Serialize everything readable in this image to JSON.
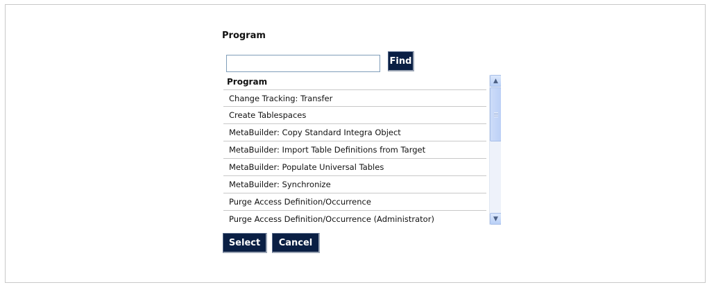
{
  "dialog": {
    "title": "Program"
  },
  "search": {
    "value": "",
    "placeholder": "",
    "find_label": "Find"
  },
  "list": {
    "header": "Program",
    "items": [
      "Change Tracking: Transfer",
      "Create Tablespaces",
      "MetaBuilder: Copy Standard Integra Object",
      "MetaBuilder: Import Table Definitions from Target",
      "MetaBuilder: Populate Universal Tables",
      "MetaBuilder: Synchronize",
      "Purge Access Definition/Occurrence",
      "Purge Access Definition/Occurrence (Administrator)"
    ]
  },
  "actions": {
    "select_label": "Select",
    "cancel_label": "Cancel"
  },
  "icons": {
    "scroll_up": "chevron-up-icon",
    "scroll_down": "chevron-down-icon"
  },
  "colors": {
    "button_bg": "#0a1f44",
    "button_text": "#ffffff"
  }
}
